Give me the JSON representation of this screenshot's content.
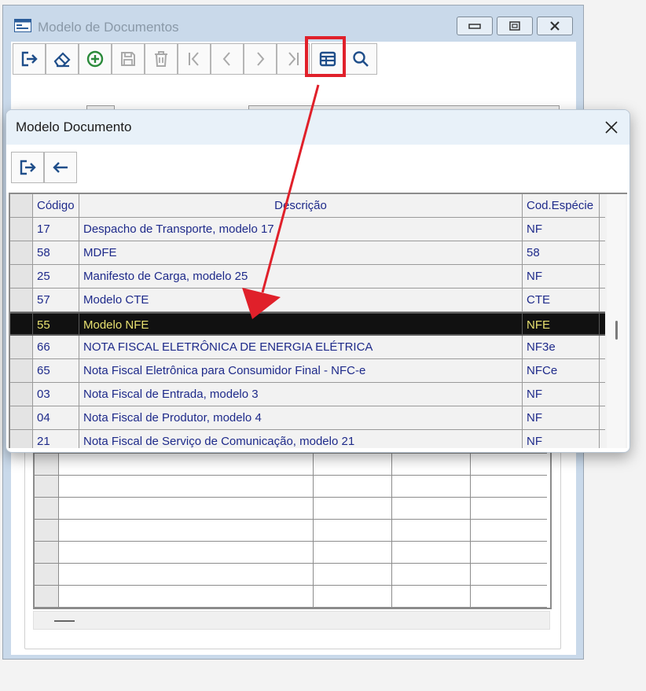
{
  "main_window": {
    "title": "Modelo de Documentos",
    "controls": [
      "minimize",
      "maximize",
      "close"
    ],
    "toolbar_icons": [
      "exit-icon",
      "eraser-icon",
      "add-circle-icon",
      "save-icon",
      "trash-icon",
      "first-record-icon",
      "previous-record-icon",
      "next-record-icon",
      "last-record-icon",
      "table-icon",
      "search-icon"
    ]
  },
  "dialog": {
    "title": "Modelo Documento",
    "toolbar_icons": [
      "exit-icon",
      "back-arrow-icon"
    ],
    "grid": {
      "columns": [
        "Código",
        "Descrição",
        "Cod.Espécie"
      ],
      "rows": [
        {
          "codigo": "17",
          "descricao": "Despacho de Transporte, modelo 17",
          "especie": "NF"
        },
        {
          "codigo": "58",
          "descricao": "MDFE",
          "especie": "58"
        },
        {
          "codigo": "25",
          "descricao": "Manifesto de Carga, modelo 25",
          "especie": "NF"
        },
        {
          "codigo": "57",
          "descricao": "Modelo CTE",
          "especie": "CTE"
        },
        {
          "codigo": "55",
          "descricao": "Modelo NFE",
          "especie": "NFE",
          "selected": true
        },
        {
          "codigo": "66",
          "descricao": "NOTA FISCAL ELETRÔNICA DE ENERGIA ELÉTRICA",
          "especie": "NF3e"
        },
        {
          "codigo": "65",
          "descricao": "Nota Fiscal Eletrônica para Consumidor Final - NFC-e",
          "especie": "NFCe"
        },
        {
          "codigo": "03",
          "descricao": "Nota Fiscal de Entrada, modelo 3",
          "especie": "NF"
        },
        {
          "codigo": "04",
          "descricao": "Nota Fiscal de Produtor, modelo 4",
          "especie": "NF"
        },
        {
          "codigo": "21",
          "descricao": "Nota Fiscal de Serviço de Comunicação, modelo 21",
          "especie": "NF"
        }
      ]
    }
  },
  "annotation": {
    "color": "#e0202a"
  }
}
